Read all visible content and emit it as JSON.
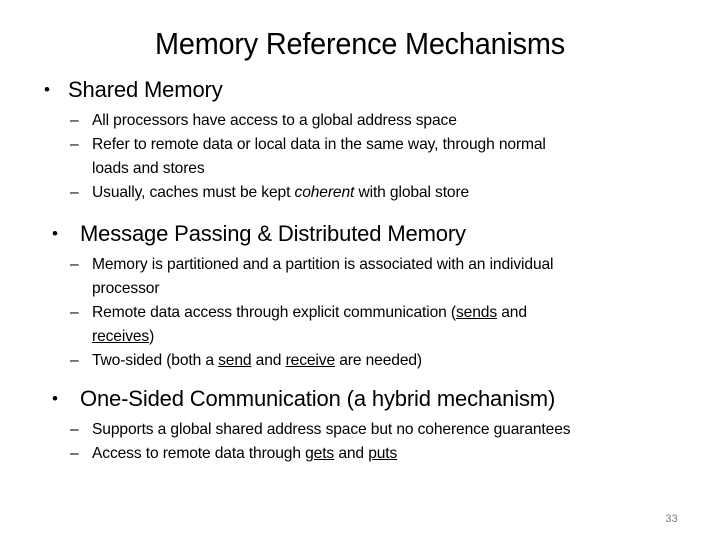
{
  "slide": {
    "title": "Memory Reference Mechanisms",
    "page_number": "33",
    "bullet_glyph": "•",
    "dash_glyph": "–",
    "colors": {
      "background": "#ffffff",
      "text": "#000000",
      "page_number": "#808080"
    },
    "sections": [
      {
        "heading": "Shared Memory",
        "items": [
          {
            "lines": [
              "All processors have access to a global address space"
            ]
          },
          {
            "lines": [
              "Refer to remote data or local data in the same way, through normal",
              "loads and stores"
            ]
          },
          {
            "prefix": "Usually, caches must be kept ",
            "italic": "coherent",
            "suffix": " with global store"
          }
        ]
      },
      {
        "heading": "Message Passing & Distributed Memory",
        "items": [
          {
            "lines": [
              "Memory is partitioned and a partition is associated with an individual",
              "processor"
            ]
          },
          {
            "prefix": "Remote data access through explicit communication (",
            "underline1": "sends",
            "mid": " and",
            "underline2": "receives",
            "suffix": ")"
          },
          {
            "prefix": "Two-sided (both a ",
            "underline1": "send",
            "mid": " and ",
            "underline2": "receive",
            "suffix": " are needed)"
          }
        ]
      },
      {
        "heading": "One-Sided Communication (a hybrid mechanism)",
        "items": [
          {
            "lines": [
              "Supports a global shared address space but no coherence guarantees"
            ]
          },
          {
            "prefix": "Access to remote data through ",
            "underline1": "gets",
            "mid": " and ",
            "underline2": "puts",
            "suffix": ""
          }
        ]
      }
    ]
  }
}
